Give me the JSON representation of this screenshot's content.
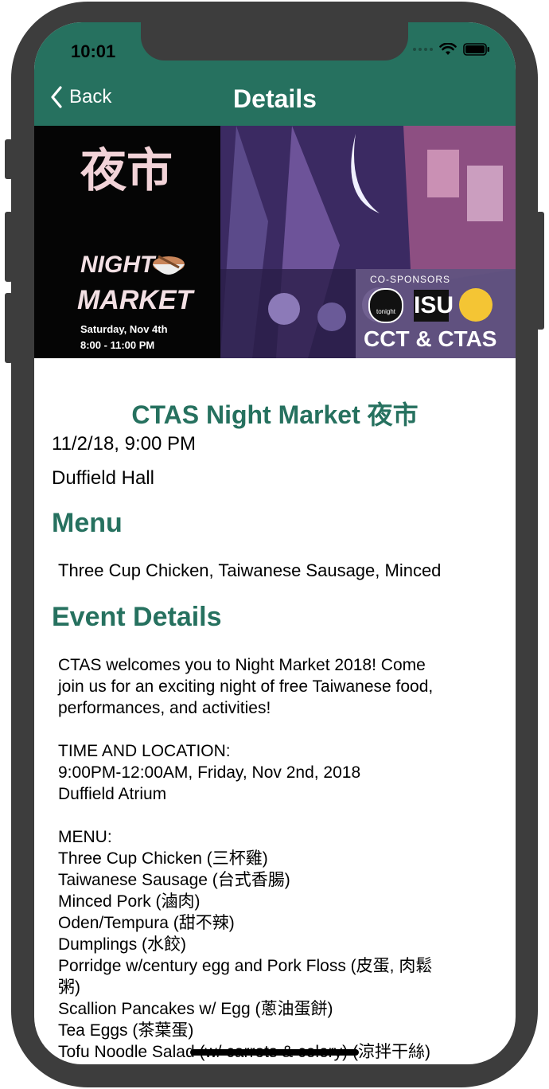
{
  "status": {
    "time": "10:01"
  },
  "nav": {
    "back_label": "Back",
    "title": "Details"
  },
  "banner": {
    "chinese_title": "夜市",
    "line1": "NIGHT",
    "line2": "MARKET",
    "date": "Saturday, Nov 4th",
    "time": "8:00 - 11:00 PM",
    "cosponsors_label": "CO-SPONSORS",
    "sponsor_isu": "ISU",
    "sponsor_cu": "tonight",
    "presenter": "CCT & CTAS"
  },
  "event": {
    "title": "CTAS Night Market 夜市",
    "datetime": "11/2/18, 9:00 PM",
    "location": "Duffield Hall"
  },
  "menu_section": {
    "heading": "Menu",
    "summary": "Three Cup Chicken, Taiwanese Sausage, Minced"
  },
  "details_section": {
    "heading": "Event Details",
    "lines": [
      "CTAS welcomes you to Night Market 2018! Come",
      "join us for an exciting night of free Taiwanese food,",
      "performances, and activities!",
      "",
      "TIME AND LOCATION:",
      "9:00PM-12:00AM, Friday, Nov 2nd, 2018",
      "Duffield Atrium",
      "",
      "MENU:",
      "Three Cup Chicken (三杯雞)",
      "Taiwanese Sausage (台式香腸)",
      "Minced Pork (滷肉)",
      "Oden/Tempura (甜不辣)",
      "Dumplings (水餃)",
      "Porridge w/century egg and Pork Floss (皮蛋, 肉鬆",
      "粥)",
      "Scallion Pancakes w/ Egg (蔥油蛋餅)",
      "Tea Eggs (茶葉蛋)",
      "Tofu Noodle Salad (w/ carrots & celery) (涼拌干絲)"
    ]
  },
  "colors": {
    "accent": "#26715f",
    "frame": "#3d3d3d"
  }
}
